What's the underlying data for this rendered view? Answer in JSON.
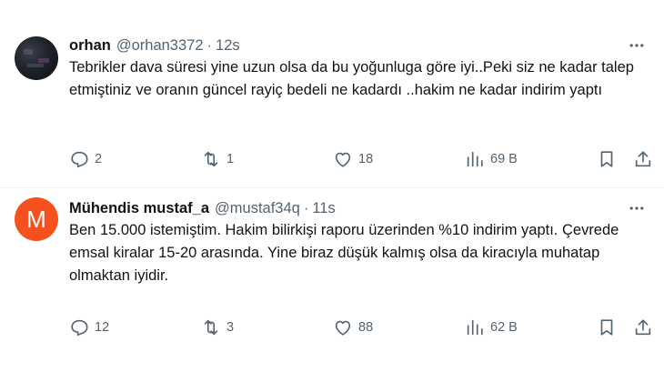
{
  "tweets": [
    {
      "avatar": {
        "kind": "photo"
      },
      "name": "orhan",
      "handle": "@orhan3372",
      "separator": "·",
      "time": "12s",
      "text": "Tebrikler dava süresi yine uzun olsa da bu yoğunluga göre iyi..Peki siz ne kadar talep etmiştiniz ve oranın güncel rayiç bedeli ne kadardı ..hakim ne kadar indirim yaptı",
      "replies": "2",
      "reposts": "1",
      "likes": "18",
      "views": "69 B"
    },
    {
      "avatar": {
        "kind": "letter",
        "letter": "M",
        "color": "#f4511e"
      },
      "name": "Mühendis mustaf_a",
      "handle": "@mustaf34q",
      "separator": "·",
      "time": "11s",
      "text": "Ben 15.000 istemiştim. Hakim bilirkişi raporu üzerinden %10 indirim yaptı. Çevrede emsal kiralar 15-20 arasında. Yine biraz düşük kalmış olsa da kiracıyla muhatap olmaktan iyidir.",
      "replies": "12",
      "reposts": "3",
      "likes": "88",
      "views": "62 B"
    }
  ],
  "icons": {
    "more": "more-horizontal-icon",
    "reply": "reply-icon",
    "repost": "repost-icon",
    "like": "heart-icon",
    "views": "views-chart-icon",
    "bookmark": "bookmark-icon",
    "share": "share-icon"
  },
  "colors": {
    "text": "#0f1419",
    "secondary": "#536471",
    "divider": "#eff3f4",
    "avatar_letter_bg": "#f4511e"
  }
}
